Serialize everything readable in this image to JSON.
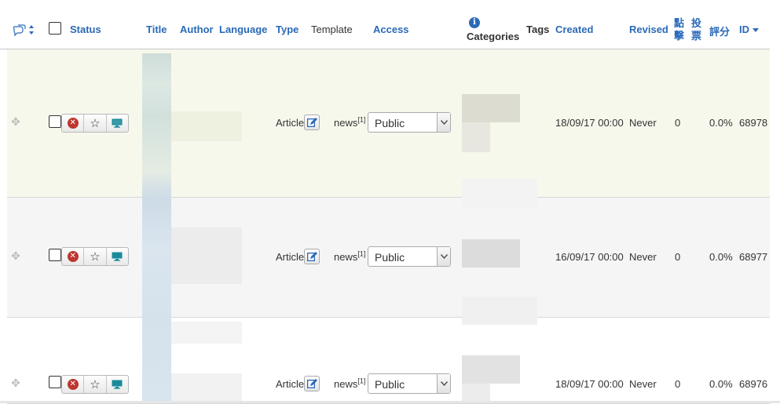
{
  "columns": {
    "status": "Status",
    "title": "Title",
    "author": "Author",
    "language": "Language",
    "type": "Type",
    "template": "Template",
    "access": "Access",
    "categories": "Categories",
    "tags": "Tags",
    "created": "Created",
    "revised": "Revised",
    "hits": "點擊",
    "votes": "投票",
    "rating": "評分",
    "id": "ID"
  },
  "rows": [
    {
      "type": "Article",
      "template": "news",
      "template_sup": "[1]",
      "access": "Public",
      "created": "18/09/17 00:00",
      "revised": "Never",
      "hits": "0",
      "rating": "0.0%",
      "id": "68978"
    },
    {
      "type": "Article",
      "template": "news",
      "template_sup": "[1]",
      "access": "Public",
      "created": "16/09/17 00:00",
      "revised": "Never",
      "hits": "0",
      "rating": "0.0%",
      "id": "68977"
    },
    {
      "type": "Article",
      "template": "news",
      "template_sup": "[1]",
      "access": "Public",
      "created": "18/09/17 00:00",
      "revised": "Never",
      "hits": "0",
      "rating": "0.0%",
      "id": "68976"
    }
  ],
  "colors": {
    "link": "#2a69b8",
    "unpublish": "#bd362f",
    "frontend": "#1a8a9a",
    "row_highlight": "#f7f8ec"
  },
  "icons": {
    "ordering": "ordering-icon",
    "drag": "drag-handle-icon",
    "unpublish": "unpublish-icon",
    "featured": "star-icon",
    "frontend": "monitor-icon",
    "edit": "edit-icon",
    "info": "info-icon"
  }
}
